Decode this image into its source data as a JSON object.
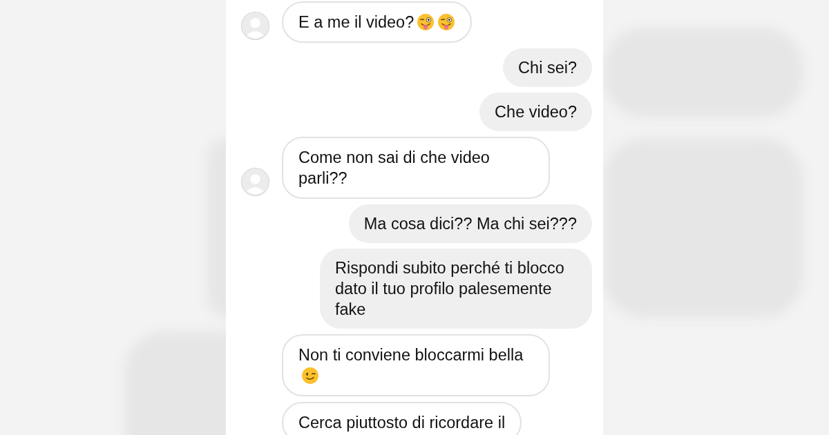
{
  "messages": [
    {
      "kind": "received",
      "avatar": true,
      "text": "E a me il video?",
      "emojis": [
        {
          "kind": "tongue-wink"
        },
        {
          "kind": "tongue-wink"
        }
      ]
    },
    {
      "kind": "sent",
      "text": "Chi sei?"
    },
    {
      "kind": "sent",
      "text": "Che video?"
    },
    {
      "kind": "received",
      "avatar": true,
      "text": "Come non sai di che video parli??"
    },
    {
      "kind": "sent",
      "text": "Ma cosa dici?? Ma chi sei???"
    },
    {
      "kind": "sent",
      "text": "Rispondi subito perché ti blocco dato il tuo profilo palesemente fake"
    },
    {
      "kind": "received",
      "avatar": false,
      "text": "Non ti conviene bloccarmi bella",
      "emojis": [
        {
          "kind": "wink"
        }
      ]
    },
    {
      "kind": "received",
      "avatar": false,
      "text": "Cerca piuttosto di ricordare il"
    }
  ]
}
